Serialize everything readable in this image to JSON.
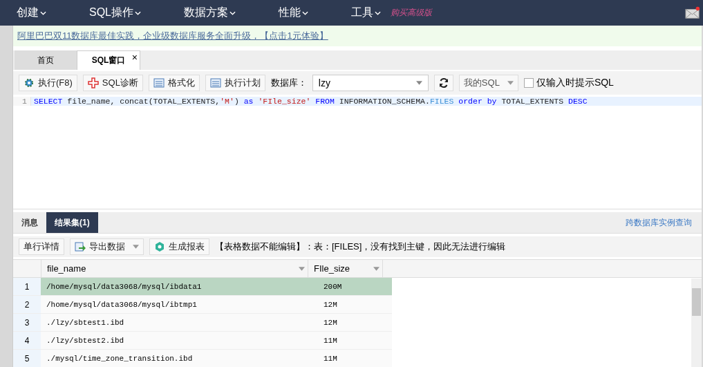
{
  "nav": {
    "items": [
      "创建",
      "SQL操作",
      "数据方案",
      "性能",
      "工具"
    ],
    "promo": "购买高级版",
    "has_notification": true
  },
  "banner": {
    "text": "阿里巴巴双11数据库最佳实践，企业级数据库服务全面升级，【点击1元体验】"
  },
  "tabs": [
    {
      "label": "首页",
      "selected": false
    },
    {
      "label": "SQL窗口",
      "selected": true,
      "close": "×"
    }
  ],
  "toolbar": {
    "buttons": [
      {
        "label": "执行(F8)",
        "kind": "gear"
      },
      {
        "label": "SQL诊断",
        "kind": "cross"
      },
      {
        "label": "格式化",
        "kind": "list"
      },
      {
        "label": "执行计划",
        "kind": "list"
      }
    ],
    "database_label": "数据库：",
    "database": "lzy",
    "my_sql": "我的SQL",
    "hint_checkbox": {
      "label": "仅输入时提示SQL",
      "checked": false
    }
  },
  "editor": {
    "lines": [
      {
        "number": "1",
        "tokens": [
          {
            "text": "SELECT",
            "kind": "keyword"
          },
          {
            "text": " file_name, concat(TOTAL_EXTENTS,",
            "kind": "plain"
          },
          {
            "text": "'M'",
            "kind": "string"
          },
          {
            "text": ") ",
            "kind": "plain"
          },
          {
            "text": "as",
            "kind": "keyword"
          },
          {
            "text": " 'FIle_size' ",
            "kind": "string"
          },
          {
            "text": "FROM",
            "kind": "keyword"
          },
          {
            "text": " INFORMATION_SCHEMA.",
            "kind": "plain"
          },
          {
            "text": "FILES ",
            "kind": "table"
          },
          {
            "text": "order by",
            "kind": "keyword"
          },
          {
            "text": " TOTAL_EXTENTS ",
            "kind": "plain"
          },
          {
            "text": "DESC",
            "kind": "keyword"
          }
        ]
      }
    ]
  },
  "result_tabs": [
    {
      "label": "消息",
      "selected": false
    },
    {
      "label": "结果集(1)",
      "selected": true
    }
  ],
  "cross_db_link": "跨数据库实例查询",
  "result_toolbar": {
    "buttons": [
      {
        "label": "单行详情",
        "kind": "plain"
      },
      {
        "label": "导出数据",
        "kind": "export",
        "dropdown": true
      },
      {
        "label": "生成报表",
        "kind": "chart"
      }
    ],
    "notice": "【表格数据不能编辑】：表：[FILES]，没有找到主键，因此无法进行编辑"
  },
  "table": {
    "columns": [
      "file_name",
      "FIle_size"
    ],
    "rows": [
      {
        "number": "1",
        "cells": [
          "/home/mysql/data3068/mysql/ibdata1",
          "200M"
        ],
        "selected": true
      },
      {
        "number": "2",
        "cells": [
          "/home/mysql/data3068/mysql/ibtmp1",
          "12M"
        ],
        "selected": false
      },
      {
        "number": "3",
        "cells": [
          "./lzy/sbtest1.ibd",
          "12M"
        ],
        "selected": false
      },
      {
        "number": "4",
        "cells": [
          "./lzy/sbtest2.ibd",
          "11M"
        ],
        "selected": false
      },
      {
        "number": "5",
        "cells": [
          "./mysql/time_zone_transition.ibd",
          "11M"
        ],
        "selected": false
      }
    ]
  }
}
